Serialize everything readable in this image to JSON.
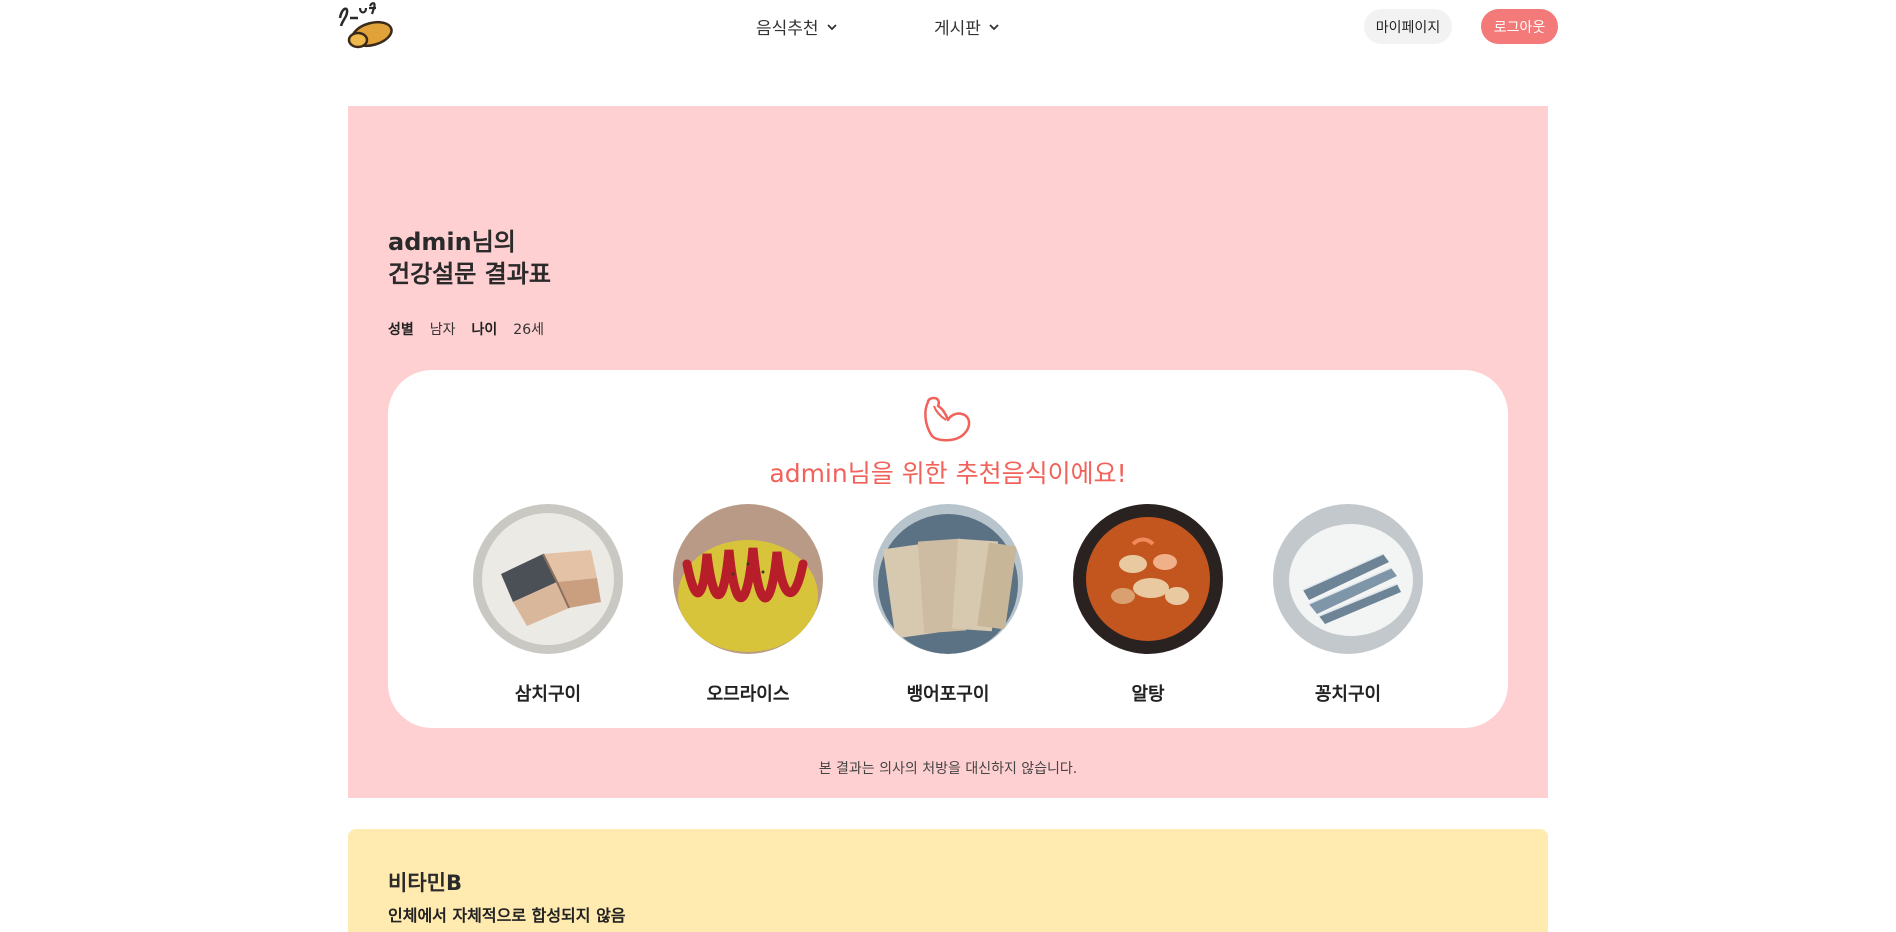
{
  "header": {
    "logo_text": "P-nut",
    "nav": [
      {
        "label": "음식추천"
      },
      {
        "label": "게시판"
      }
    ],
    "mypage_label": "마이페이지",
    "logout_label": "로그아웃",
    "colors": {
      "logout_bg": "#f47a7a",
      "mypage_bg": "#f2f2f2"
    }
  },
  "result": {
    "title_line1": "admin님의",
    "title_line2": "건강설문 결과표",
    "gender_label": "성별",
    "gender_value": "남자",
    "age_label": "나이",
    "age_value": "26세",
    "recommend_heading": "admin님을 위한 추천음식이에요!",
    "foods": [
      {
        "name": "삼치구이",
        "image": "grilled-mackerel-photo"
      },
      {
        "name": "오므라이스",
        "image": "omurice-photo"
      },
      {
        "name": "뱅어포구이",
        "image": "grilled-whitebait-sheet-photo"
      },
      {
        "name": "알탕",
        "image": "pollock-roe-stew-photo"
      },
      {
        "name": "꽁치구이",
        "image": "grilled-saury-photo"
      }
    ],
    "disclaimer": "본 결과는 의사의 처방을 대신하지 않습니다.",
    "colors": {
      "panel_bg": "#ffd0d2",
      "heading": "#f0625a"
    }
  },
  "vitamin": {
    "title": "비타민B",
    "subtitle": "인체에서 자체적으로 합성되지 않음",
    "colors": {
      "panel_bg": "#ffeab0"
    }
  }
}
